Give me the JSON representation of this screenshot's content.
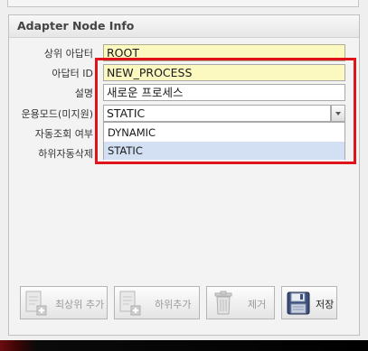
{
  "panel": {
    "title": "Adapter Node Info"
  },
  "form": {
    "rows": [
      {
        "label": "상위 아답터",
        "value": "ROOT"
      },
      {
        "label": "아답터 ID",
        "value": "NEW_PROCESS"
      },
      {
        "label": "설명",
        "value": "새로운 프로세스"
      },
      {
        "label": "운용모드(미지원)",
        "value": "STATIC"
      },
      {
        "label": "자동조회 여부",
        "value": ""
      },
      {
        "label": "하위자동삭제",
        "value": ""
      }
    ]
  },
  "dropdown": {
    "options": [
      "DYNAMIC",
      "STATIC"
    ],
    "selected": "STATIC"
  },
  "buttons": {
    "add_top": "최상위 추가",
    "add_child": "하위추가",
    "delete": "제거",
    "save": "저장"
  },
  "colors": {
    "highlight": "#e1131a",
    "readonly_field": "#fbf8c0",
    "dropdown_selected": "#d3e0f3"
  }
}
